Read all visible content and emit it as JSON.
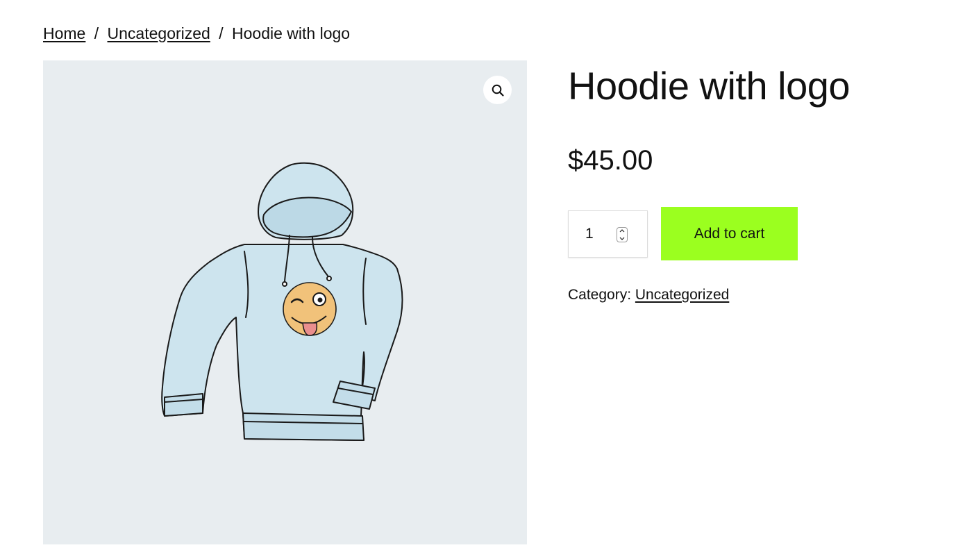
{
  "breadcrumb": {
    "home": "Home",
    "separator": "/",
    "category": "Uncategorized",
    "current": "Hoodie with logo"
  },
  "gallery": {
    "zoom_icon": "magnifier-icon",
    "image_subject": "hoodie-with-winking-emoji-logo"
  },
  "product": {
    "title": "Hoodie with logo",
    "price": "$45.00",
    "quantity": "1",
    "add_to_cart_label": "Add to cart",
    "category_label": "Category:",
    "category_link": "Uncategorized"
  },
  "colors": {
    "button_bg": "#9bff1f",
    "gallery_bg": "#e8edf0",
    "hoodie_fill": "#cde4ee",
    "emoji_fill": "#f1c27a",
    "tongue_fill": "#ea8e8e"
  }
}
